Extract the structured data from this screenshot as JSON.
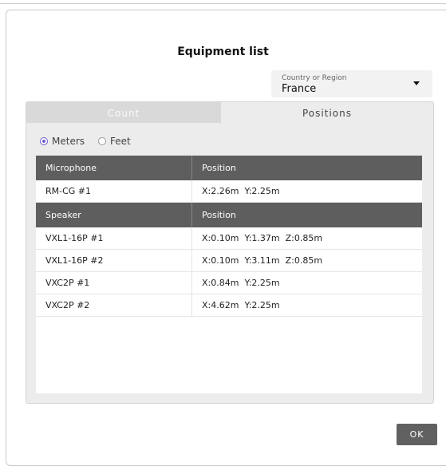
{
  "dialog": {
    "title": "Equipment list"
  },
  "region": {
    "label": "Country or Region",
    "value": "France"
  },
  "tabs": [
    {
      "label": "Count",
      "active": false
    },
    {
      "label": "Positions",
      "active": true
    }
  ],
  "units": {
    "options": [
      "Meters",
      "Feet"
    ],
    "selected": "Meters"
  },
  "microphone_table": {
    "headers": [
      "Microphone",
      "Position"
    ],
    "rows": [
      {
        "name": "RM-CG #1",
        "position": "X:2.26m  Y:2.25m"
      }
    ]
  },
  "speaker_table": {
    "headers": [
      "Speaker",
      "Position"
    ],
    "rows": [
      {
        "name": "VXL1-16P #1",
        "position": "X:0.10m  Y:1.37m  Z:0.85m"
      },
      {
        "name": "VXL1-16P #2",
        "position": "X:0.10m  Y:3.11m  Z:0.85m"
      },
      {
        "name": "VXC2P #1",
        "position": "X:0.84m  Y:2.25m"
      },
      {
        "name": "VXC2P #2",
        "position": "X:4.62m  Y:2.25m"
      }
    ]
  },
  "footer": {
    "ok_label": "OK"
  },
  "colors": {
    "accent": "#6d5acd",
    "header_bg": "#5e5e5e",
    "ok_bg": "#616161"
  }
}
